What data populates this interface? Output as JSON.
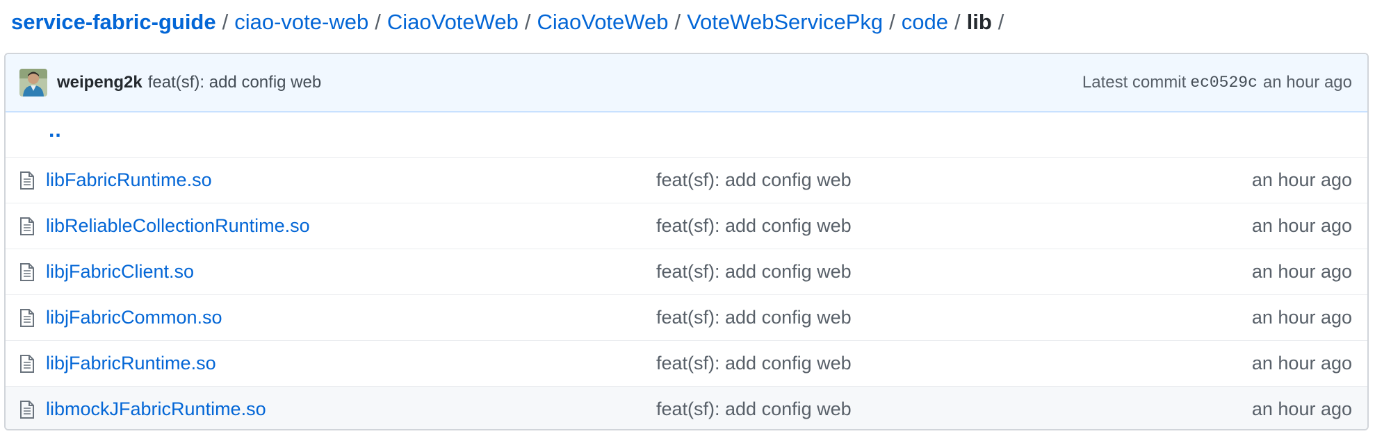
{
  "breadcrumb": {
    "items": [
      "service-fabric-guide",
      "ciao-vote-web",
      "CiaoVoteWeb",
      "CiaoVoteWeb",
      "VoteWebServicePkg",
      "code"
    ],
    "current": "lib",
    "separator": "/"
  },
  "commit": {
    "author": "weipeng2k",
    "message": "feat(sf): add config web",
    "latest_label": "Latest commit",
    "sha": "ec0529c",
    "age": "an hour ago"
  },
  "parent_link": "..",
  "files": [
    {
      "name": "libFabricRuntime.so",
      "message": "feat(sf): add config web",
      "age": "an hour ago",
      "icon": "file-icon"
    },
    {
      "name": "libReliableCollectionRuntime.so",
      "message": "feat(sf): add config web",
      "age": "an hour ago",
      "icon": "file-icon"
    },
    {
      "name": "libjFabricClient.so",
      "message": "feat(sf): add config web",
      "age": "an hour ago",
      "icon": "file-icon"
    },
    {
      "name": "libjFabricCommon.so",
      "message": "feat(sf): add config web",
      "age": "an hour ago",
      "icon": "file-icon"
    },
    {
      "name": "libjFabricRuntime.so",
      "message": "feat(sf): add config web",
      "age": "an hour ago",
      "icon": "file-icon"
    },
    {
      "name": "libmockJFabricRuntime.so",
      "message": "feat(sf): add config web",
      "age": "an hour ago",
      "icon": "file-icon"
    }
  ],
  "colors": {
    "link": "#0366d6",
    "text": "#24292e",
    "muted": "#586069",
    "commit_bar_bg": "#f1f8ff",
    "commit_bar_border": "#c8e1ff",
    "border": "#d1d5da"
  }
}
